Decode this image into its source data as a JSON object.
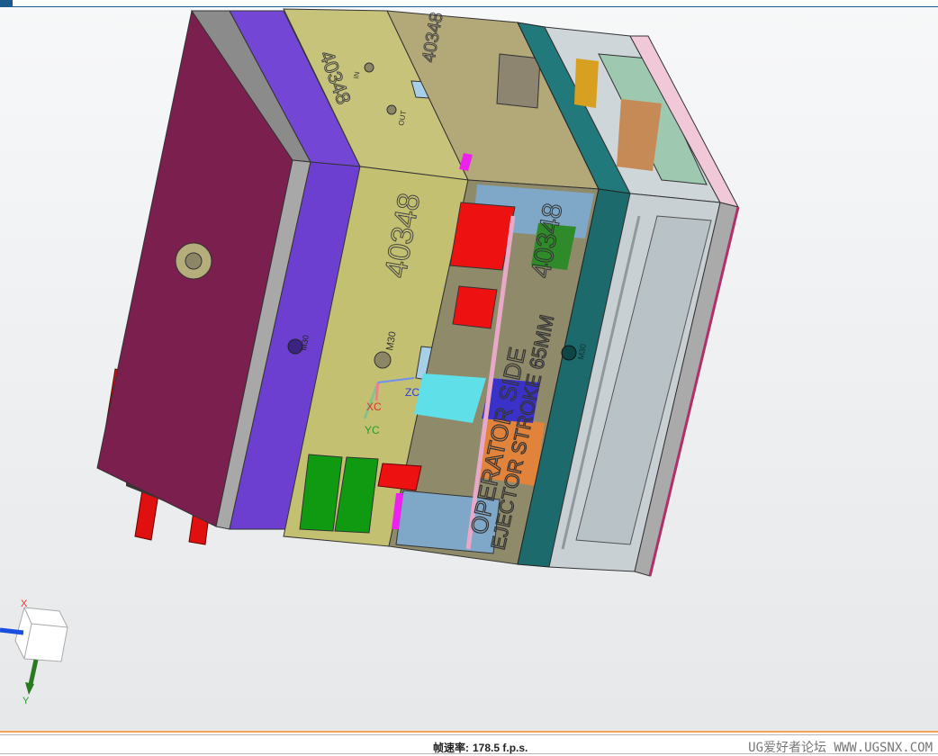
{
  "status": {
    "fps_label": "帧速率:",
    "fps_value": "178.5 f.p.s.",
    "watermark": "UG爱好者论坛 WWW.UGSNX.COM"
  },
  "model": {
    "part_number": "40348",
    "bolt_label": "M30",
    "operator_side": "OPERATOR SIDE",
    "ejector_stroke": "EJECTOR STROKE 65MM",
    "tags": [
      "IN",
      "OUT"
    ]
  },
  "wcs": {
    "x": "XC",
    "y": "YC",
    "z": "ZC"
  },
  "triad": {
    "x": "X",
    "y": "Y"
  },
  "colors": {
    "clamp_plate": "#7a1f4e",
    "purple_plate": "#6d3fd0",
    "a_plate": "#c4c072",
    "b_plate": "#b3a877",
    "support_plate": "#1d6a6c",
    "ejector_housing": "#c8d0d4",
    "accent_red": "#ee1111",
    "accent_green": "#0f9a12"
  }
}
